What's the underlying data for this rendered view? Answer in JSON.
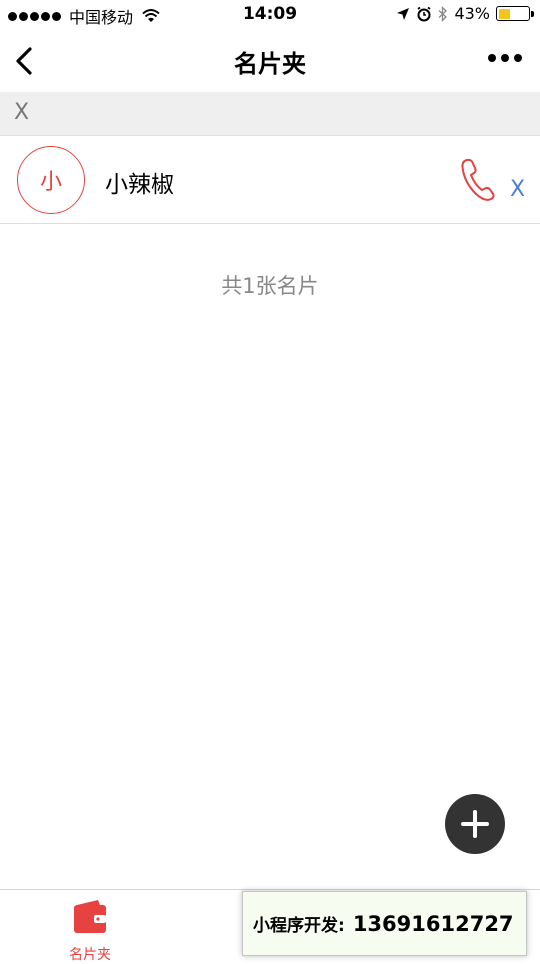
{
  "status_bar": {
    "carrier": "中国移动",
    "time": "14:09",
    "battery_text": "43%",
    "battery_level": 0.43
  },
  "nav": {
    "title": "名片夹"
  },
  "search": {
    "clear_label": "X"
  },
  "contacts": [
    {
      "avatar_char": "小",
      "name": "小辣椒",
      "delete_label": "X"
    }
  ],
  "summary": {
    "count_text": "共1张名片"
  },
  "tab_bar": {
    "items": [
      {
        "label": "名片夹",
        "active": true
      }
    ]
  },
  "dev_banner": {
    "label": "小程序开发:",
    "phone": "13691612727"
  },
  "colors": {
    "accent": "#e64340",
    "link": "#4a7fd6",
    "fab": "#333333",
    "battery": "#f5c518"
  }
}
